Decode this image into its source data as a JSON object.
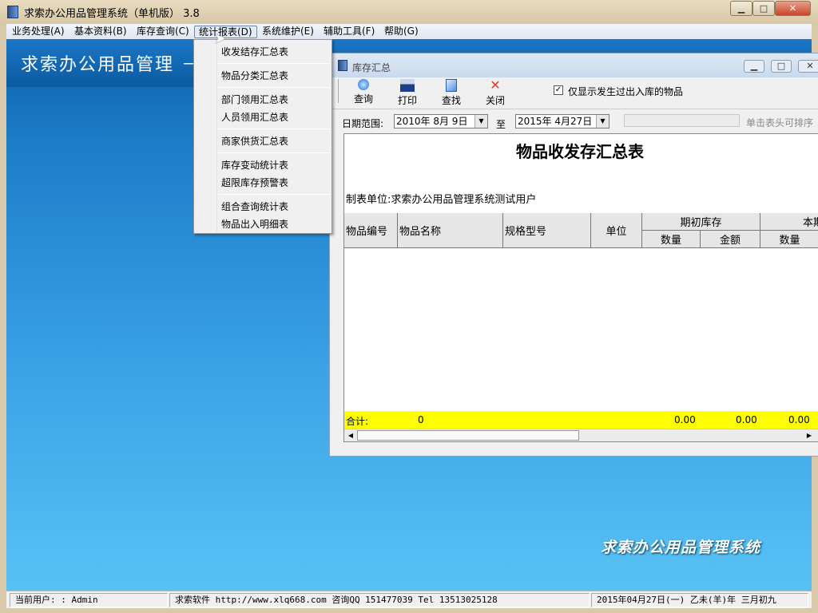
{
  "window": {
    "title": "求索办公用品管理系统（单机版） 3.8"
  },
  "menubar": [
    "业务处理(A)",
    "基本资料(B)",
    "库存查询(C)",
    "统计报表(D)",
    "系统维护(E)",
    "辅助工具(F)",
    "帮助(G)"
  ],
  "banner_title": "求索办公用品管理 －",
  "dropdown": [
    "收发结存汇总表",
    "物品分类汇总表",
    "部门领用汇总表",
    "人员领用汇总表",
    "商家供货汇总表",
    "库存变动统计表",
    "超限库存预警表",
    "组合查询统计表",
    "物品出入明细表"
  ],
  "child": {
    "title": "库存汇总",
    "toolbar": [
      "查询",
      "打印",
      "查找",
      "关闭"
    ],
    "checkbox_label": "仅显示发生过出入库的物品",
    "checkbox_checked": true,
    "date_label": "日期范围:",
    "date_from": "2010年 8月 9日",
    "to_label": "至",
    "date_to": "2015年 4月27日",
    "sort_hint": "单击表头可排序",
    "report_title": "物品收发存汇总表",
    "unit_label": "制表单位:求索办公用品管理系统测试用户",
    "headers": {
      "code": "物品编号",
      "name": "物品名称",
      "spec": "规格型号",
      "unit": "单位",
      "opening": "期初库存",
      "current": "本期",
      "qty": "数量",
      "amount": "金额",
      "qty2": "数量"
    },
    "totals": {
      "label": "合计:",
      "count": "0",
      "opening_qty": "0.00",
      "opening_amount": "0.00",
      "current_qty": "0.00"
    }
  },
  "logo_text": "求索办公用品管理系统",
  "status": {
    "user": "当前用户: : Admin",
    "company": "求索软件  http://www.xlq668.com  咨询QQ 151477039  Tel 13513025128",
    "date": "2015年04月27日(一) 乙未(羊)年 三月初九"
  }
}
